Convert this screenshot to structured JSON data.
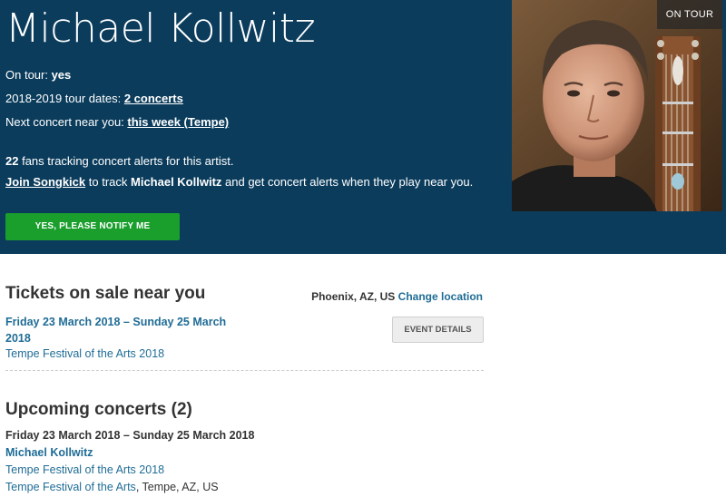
{
  "artist": {
    "name": "Michael Kollwitz",
    "on_tour_label": "On tour: ",
    "on_tour_value": "yes",
    "tour_dates_label": "2018-2019 tour dates: ",
    "tour_dates_link": "2 concerts",
    "next_concert_label": "Next concert near you: ",
    "next_concert_link": "this week (Tempe)",
    "fans_count": "22",
    "fans_text": " fans tracking concert alerts for this artist.",
    "join_link": "Join Songkick",
    "join_text_1": " to track ",
    "join_artist": "Michael Kollwitz",
    "join_text_2": " and get concert alerts when they play near you.",
    "notify_button": "YES, PLEASE NOTIFY ME",
    "badge": "ON TOUR"
  },
  "tickets": {
    "heading": "Tickets on sale near you",
    "location": "Phoenix, AZ, US",
    "change_location": "Change location",
    "event_date": "Friday 23 March 2018 – Sunday 25 March 2018",
    "event_name": "Tempe Festival of the Arts 2018",
    "event_button": "EVENT DETAILS"
  },
  "upcoming": {
    "heading": "Upcoming concerts (2)",
    "date": "Friday 23 March 2018 – Sunday 25 March 2018",
    "artist": "Michael Kollwitz",
    "festival": "Tempe Festival of the Arts 2018",
    "venue": "Tempe Festival of the Arts",
    "city": ", Tempe, AZ, US"
  },
  "colors": {
    "hero_bg": "#0b3c5c",
    "link": "#1f6c96",
    "notify_green": "#1a9e2c"
  }
}
